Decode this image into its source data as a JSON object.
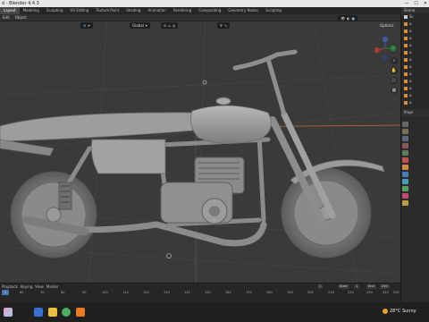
{
  "window": {
    "title": "d - Blender 4.4.3",
    "controls": [
      "—",
      "☐",
      "✕"
    ]
  },
  "workspace_tabs": [
    "Layout",
    "Modeling",
    "Sculpting",
    "UV Editing",
    "Texture Paint",
    "Shading",
    "Animation",
    "Rendering",
    "Compositing",
    "Geometry Nodes",
    "Scripting"
  ],
  "active_tab_index": 0,
  "view_header": {
    "menus": [
      "Edit",
      "Object"
    ],
    "orientation_label": "Global",
    "options_label": "Options"
  },
  "outliner": {
    "title": "Scene",
    "rows": [
      "Sc",
      "a",
      "a",
      "a",
      "a",
      "a",
      "a",
      "a",
      "a",
      "a",
      "a",
      "a",
      "a"
    ]
  },
  "properties": {
    "header": "Proje"
  },
  "timeline": {
    "frame_labels": [
      "60",
      "70",
      "80",
      "90",
      "100",
      "110",
      "120",
      "130",
      "140",
      "150",
      "160",
      "170",
      "180",
      "190",
      "200",
      "210",
      "220",
      "230",
      "240",
      "250"
    ],
    "current_frame": "1",
    "start_label": "Start",
    "start_value": "1",
    "end_label": "End",
    "end_value": "250",
    "menus": [
      "Playback",
      "Keying",
      "View",
      "Marker"
    ]
  },
  "taskbar": {
    "weather": "28°C Sunny"
  },
  "colors": {
    "accent": "#4772b3",
    "bg_viewport": "#3a3a3a",
    "floor_line": "#c06a3a"
  }
}
